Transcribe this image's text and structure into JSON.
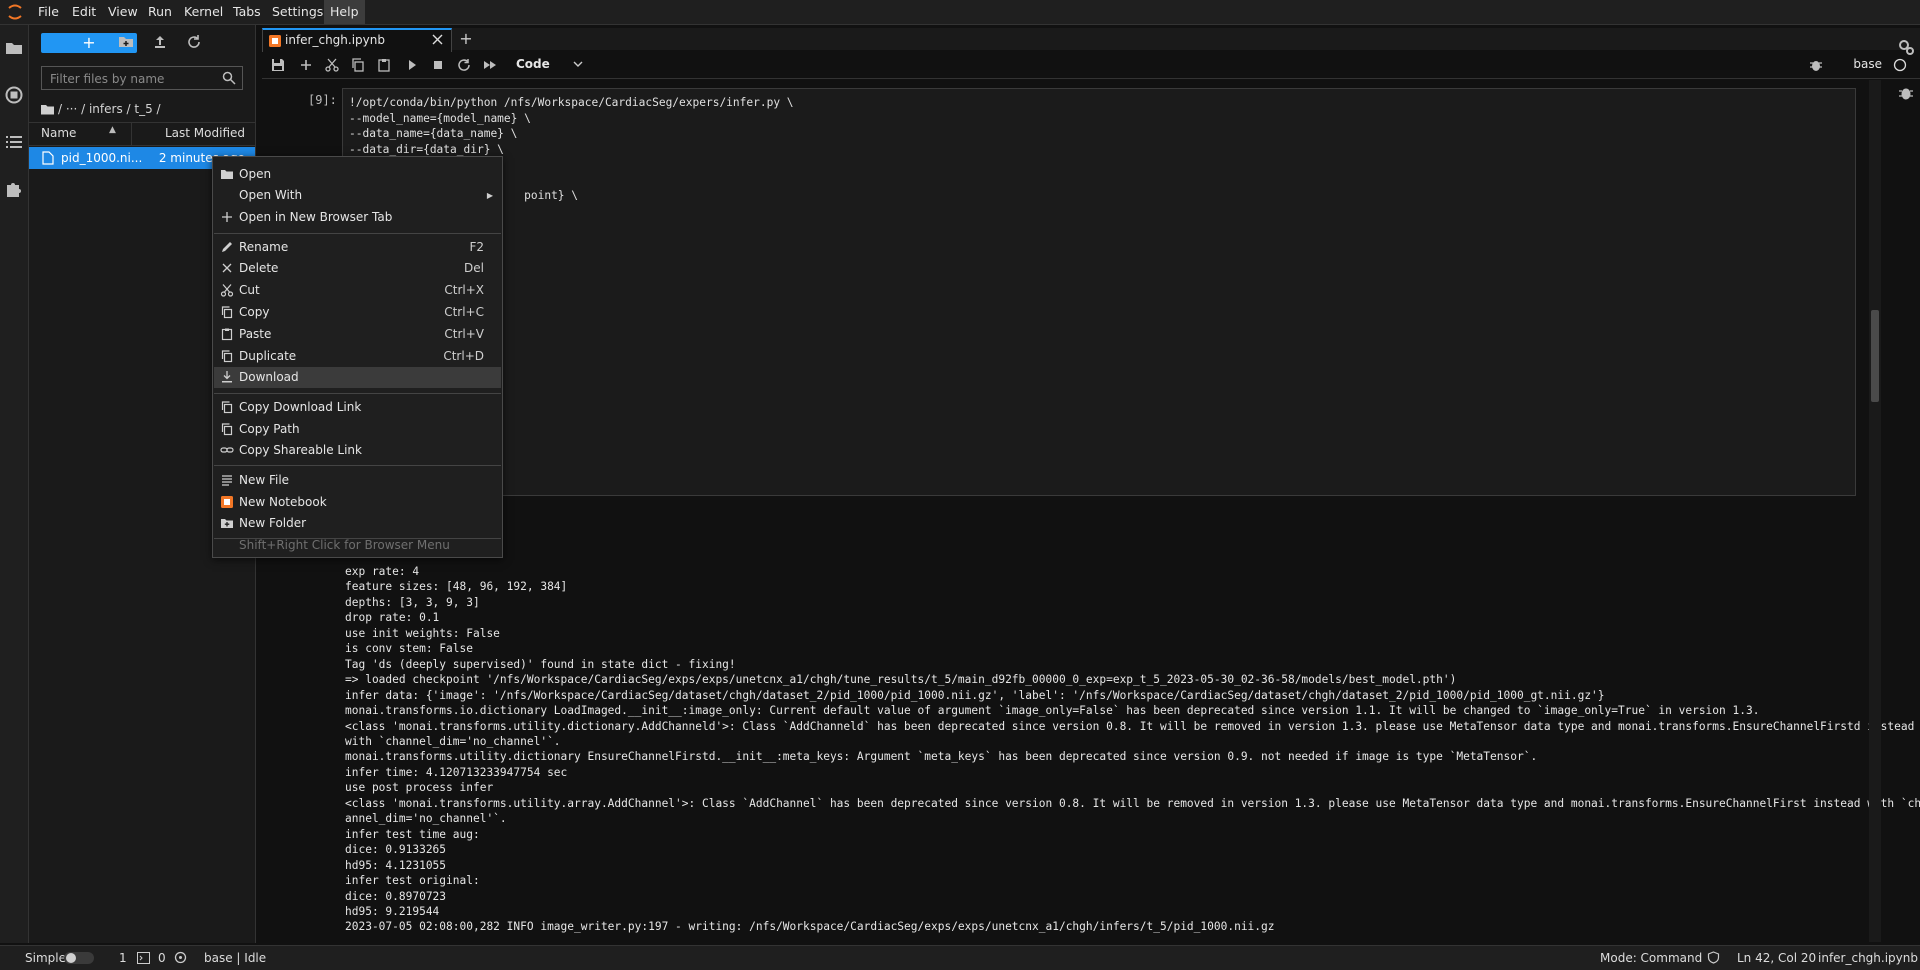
{
  "menubar": {
    "items": [
      "File",
      "Edit",
      "View",
      "Run",
      "Kernel",
      "Tabs",
      "Settings",
      "Help"
    ],
    "active": "Help"
  },
  "filebrowser": {
    "new_label": "+",
    "filter_placeholder": "Filter files by name",
    "breadcrumb": "/ ··· / infers / t_5 /",
    "columns": {
      "name": "Name",
      "modified": "Last Modified"
    },
    "files": [
      {
        "name": "pid_1000.ni...",
        "modified": "2 minutes ago"
      }
    ]
  },
  "tab": {
    "title": "infer_chgh.ipynb"
  },
  "toolbar": {
    "cell_type": "Code",
    "kernel": "base"
  },
  "cell": {
    "prompt": "[9]:",
    "code": [
      "!/opt/conda/bin/python /nfs/Workspace/CardiacSeg/expers/infer.py \\",
      "--model_name={model_name} \\",
      "--data_name={data_name} \\",
      "--data_dir={data_dir} \\",
      "",
      "",
      "                          point} \\"
    ]
  },
  "output": [
    "exp rate: 4",
    "feature sizes: [48, 96, 192, 384]",
    "depths: [3, 3, 9, 3]",
    "drop rate: 0.1",
    "use init weights: False",
    "is conv stem: False",
    "Tag 'ds (deeply supervised)' found in state dict - fixing!",
    "=> loaded checkpoint '/nfs/Workspace/CardiacSeg/exps/exps/unetcnx_a1/chgh/tune_results/t_5/main_d92fb_00000_0_exp=exp_t_5_2023-05-30_02-36-58/models/best_model.pth')",
    "infer data: {'image': '/nfs/Workspace/CardiacSeg/dataset/chgh/dataset_2/pid_1000/pid_1000.nii.gz', 'label': '/nfs/Workspace/CardiacSeg/dataset/chgh/dataset_2/pid_1000/pid_1000_gt.nii.gz'}",
    "monai.transforms.io.dictionary LoadImaged.__init__:image_only: Current default value of argument `image_only=False` has been deprecated since version 1.1. It will be changed to `image_only=True` in version 1.3.",
    "<class 'monai.transforms.utility.dictionary.AddChanneld'>: Class `AddChanneld` has been deprecated since version 0.8. It will be removed in version 1.3. please use MetaTensor data type and monai.transforms.EnsureChannelFirstd instead",
    "with `channel_dim='no_channel'`.",
    "monai.transforms.utility.dictionary EnsureChannelFirstd.__init__:meta_keys: Argument `meta_keys` has been deprecated since version 0.9. not needed if image is type `MetaTensor`.",
    "infer time: 4.120713233947754 sec",
    "use post process infer",
    "<class 'monai.transforms.utility.array.AddChannel'>: Class `AddChannel` has been deprecated since version 0.8. It will be removed in version 1.3. please use MetaTensor data type and monai.transforms.EnsureChannelFirst instead with `ch",
    "annel_dim='no_channel'`.",
    "infer test time aug:",
    "dice: 0.9133265",
    "hd95: 4.1231055",
    "infer test original:",
    "dice: 0.8970723",
    "hd95: 9.219544",
    "2023-07-05 02:08:00,282 INFO image_writer.py:197 - writing: /nfs/Workspace/CardiacSeg/exps/exps/unetcnx_a1/chgh/infers/t_5/pid_1000.nii.gz"
  ],
  "context_menu": {
    "items": [
      {
        "label": "Open",
        "shortcut": "",
        "icon": "folder-icon"
      },
      {
        "label": "Open With",
        "shortcut": "",
        "icon": ""
      },
      {
        "label": "Open in New Browser Tab",
        "shortcut": "",
        "icon": "plus-icon"
      },
      {
        "label": "Rename",
        "shortcut": "F2",
        "icon": "pencil-icon"
      },
      {
        "label": "Delete",
        "shortcut": "Del",
        "icon": "close-icon"
      },
      {
        "label": "Cut",
        "shortcut": "Ctrl+X",
        "icon": "scissors-icon"
      },
      {
        "label": "Copy",
        "shortcut": "Ctrl+C",
        "icon": "copy-icon"
      },
      {
        "label": "Paste",
        "shortcut": "Ctrl+V",
        "icon": "paste-icon"
      },
      {
        "label": "Duplicate",
        "shortcut": "Ctrl+D",
        "icon": "copy-icon"
      },
      {
        "label": "Download",
        "shortcut": "",
        "icon": "download-icon"
      },
      {
        "label": "Copy Download Link",
        "shortcut": "",
        "icon": "copy-icon"
      },
      {
        "label": "Copy Path",
        "shortcut": "",
        "icon": "copy-icon"
      },
      {
        "label": "Copy Shareable Link",
        "shortcut": "",
        "icon": "link-icon"
      },
      {
        "label": "New File",
        "shortcut": "",
        "icon": "file-lines-icon"
      },
      {
        "label": "New Notebook",
        "shortcut": "",
        "icon": "notebook-icon"
      },
      {
        "label": "New Folder",
        "shortcut": "",
        "icon": "new-folder-icon"
      },
      {
        "label": "Shift+Right Click for Browser Menu",
        "shortcut": "",
        "icon": ""
      }
    ],
    "highlighted": "Download"
  },
  "statusbar": {
    "mode_label": "Simple",
    "terminals": "1",
    "kernels": "0",
    "kernel_status": "base | Idle",
    "mode": "Mode: Command",
    "position": "Ln 42, Col 20",
    "filename": "infer_chgh.ipynb"
  },
  "colors": {
    "accent": "#2196f3",
    "selection": "#1e88e5",
    "notebook_icon": "#f37726"
  }
}
